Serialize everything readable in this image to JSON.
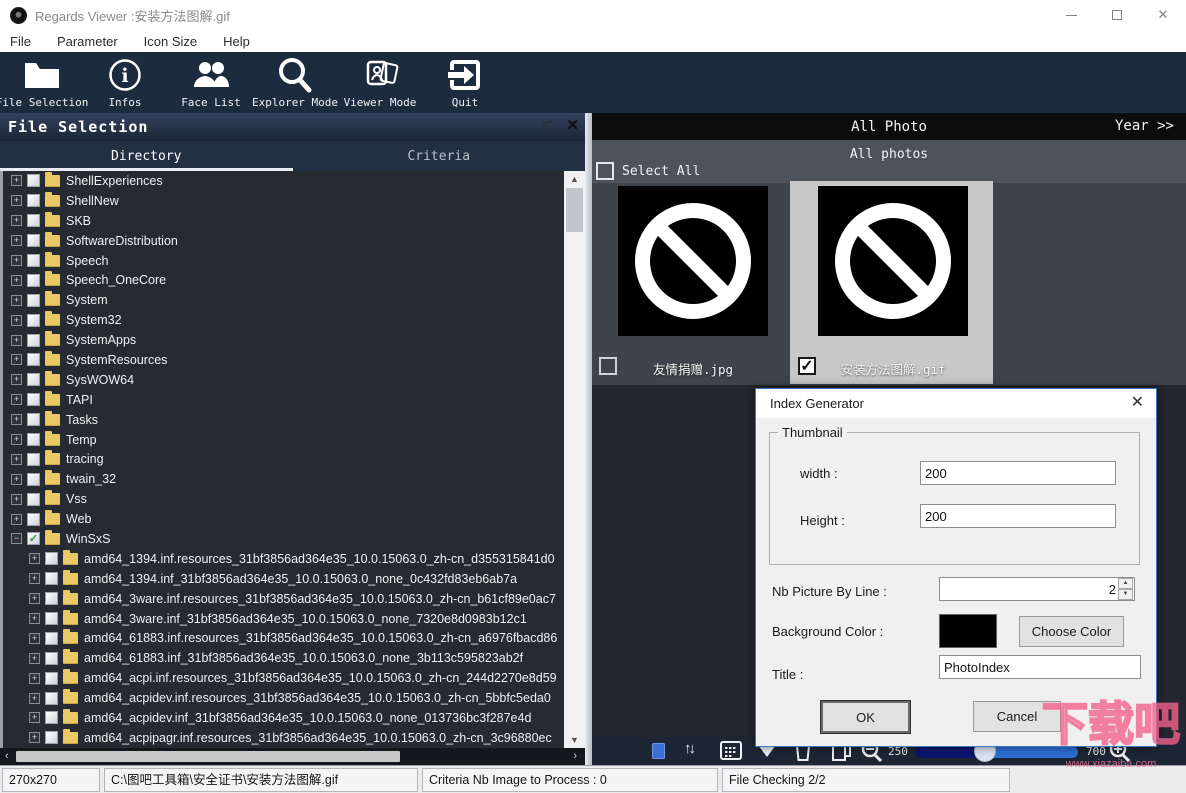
{
  "window": {
    "title": "Regards Viewer :安装方法图解.gif"
  },
  "menu": {
    "items": [
      "File",
      "Parameter",
      "Icon Size",
      "Help"
    ]
  },
  "toolbar": {
    "items": [
      {
        "label": "File Selection",
        "icon": "folder-icon"
      },
      {
        "label": "Infos",
        "icon": "info-icon"
      },
      {
        "label": "Face List",
        "icon": "people-icon"
      },
      {
        "label": "Explorer Mode",
        "icon": "magnifier-icon"
      },
      {
        "label": "Viewer Mode",
        "icon": "photo-stack-icon"
      },
      {
        "label": "Quit",
        "icon": "exit-icon"
      }
    ]
  },
  "left_panel": {
    "title": "File Selection",
    "tabs": [
      {
        "label": "Directory",
        "active": true
      },
      {
        "label": "Criteria",
        "active": false
      }
    ],
    "tree": {
      "items": [
        {
          "label": "ShellExperiences",
          "level": 1
        },
        {
          "label": "ShellNew",
          "level": 1
        },
        {
          "label": "SKB",
          "level": 1
        },
        {
          "label": "SoftwareDistribution",
          "level": 1
        },
        {
          "label": "Speech",
          "level": 1
        },
        {
          "label": "Speech_OneCore",
          "level": 1
        },
        {
          "label": "System",
          "level": 1
        },
        {
          "label": "System32",
          "level": 1
        },
        {
          "label": "SystemApps",
          "level": 1
        },
        {
          "label": "SystemResources",
          "level": 1
        },
        {
          "label": "SysWOW64",
          "level": 1
        },
        {
          "label": "TAPI",
          "level": 1
        },
        {
          "label": "Tasks",
          "level": 1
        },
        {
          "label": "Temp",
          "level": 1
        },
        {
          "label": "tracing",
          "level": 1
        },
        {
          "label": "twain_32",
          "level": 1
        },
        {
          "label": "Vss",
          "level": 1
        },
        {
          "label": "Web",
          "level": 1
        },
        {
          "label": "WinSxS",
          "level": 1,
          "checked": true,
          "expanded": true
        },
        {
          "label": "amd64_1394.inf.resources_31bf3856ad364e35_10.0.15063.0_zh-cn_d355315841d0",
          "level": 2
        },
        {
          "label": "amd64_1394.inf_31bf3856ad364e35_10.0.15063.0_none_0c432fd83eb6ab7a",
          "level": 2
        },
        {
          "label": "amd64_3ware.inf.resources_31bf3856ad364e35_10.0.15063.0_zh-cn_b61cf89e0ac7",
          "level": 2
        },
        {
          "label": "amd64_3ware.inf_31bf3856ad364e35_10.0.15063.0_none_7320e8d0983b12c1",
          "level": 2
        },
        {
          "label": "amd64_61883.inf.resources_31bf3856ad364e35_10.0.15063.0_zh-cn_a6976fbacd86",
          "level": 2
        },
        {
          "label": "amd64_61883.inf_31bf3856ad364e35_10.0.15063.0_none_3b113c595823ab2f",
          "level": 2
        },
        {
          "label": "amd64_acpi.inf.resources_31bf3856ad364e35_10.0.15063.0_zh-cn_244d2270e8d59",
          "level": 2
        },
        {
          "label": "amd64_acpidev.inf.resources_31bf3856ad364e35_10.0.15063.0_zh-cn_5bbfc5eda0",
          "level": 2
        },
        {
          "label": "amd64_acpidev.inf_31bf3856ad364e35_10.0.15063.0_none_013736bc3f287e4d",
          "level": 2
        },
        {
          "label": "amd64_acpipagr.inf.resources_31bf3856ad364e35_10.0.15063.0_zh-cn_3c96880ec",
          "level": 2
        }
      ]
    }
  },
  "right_panel": {
    "header": {
      "title": "All Photo",
      "nav": "Year >>"
    },
    "select_all_label": "Select All",
    "group_label": "All photos",
    "photos": [
      {
        "name": "友情捐赠.jpg",
        "checked": false,
        "selected": false
      },
      {
        "name": "安装方法图解.gif",
        "checked": true,
        "selected": true,
        "check_glyph": "✓"
      }
    ],
    "toolbar": {
      "zoom_min": "250",
      "zoom_max": "700"
    }
  },
  "dialog": {
    "title": "Index Generator",
    "thumbnail_group": {
      "label": "Thumbnail",
      "width_label": "width :",
      "width_value": "200",
      "height_label": "Height :",
      "height_value": "200"
    },
    "nb_picture_label": "Nb Picture By Line :",
    "nb_picture_value": "2",
    "background_color_label": "Background Color :",
    "background_color_value": "#000000",
    "choose_color_button": "Choose Color",
    "title_label": "Title :",
    "title_value": "PhotoIndex",
    "ok_button": "OK",
    "cancel_button": "Cancel"
  },
  "status_bar": {
    "sections": [
      "270x270",
      "C:\\图吧工具箱\\安全证书\\安装方法图解.gif",
      "Criteria Nb Image to Process :  0",
      "File Checking 2/2"
    ]
  },
  "watermark": {
    "text": "下载吧",
    "url": "www.xiazaiba.com"
  },
  "colors": {
    "toolbar_bg": "#1d2b3f",
    "tree_bg": "#262a31",
    "right_header_bg": "#0c0c0c",
    "band_bg": "#4d535b",
    "selected_thumb_bg": "#c8c8c8",
    "folder_icon": "#e9c865",
    "slider_left": "#0a1670",
    "slider_right": "#2e6fd6",
    "dialog_border": "#3b78c0"
  }
}
